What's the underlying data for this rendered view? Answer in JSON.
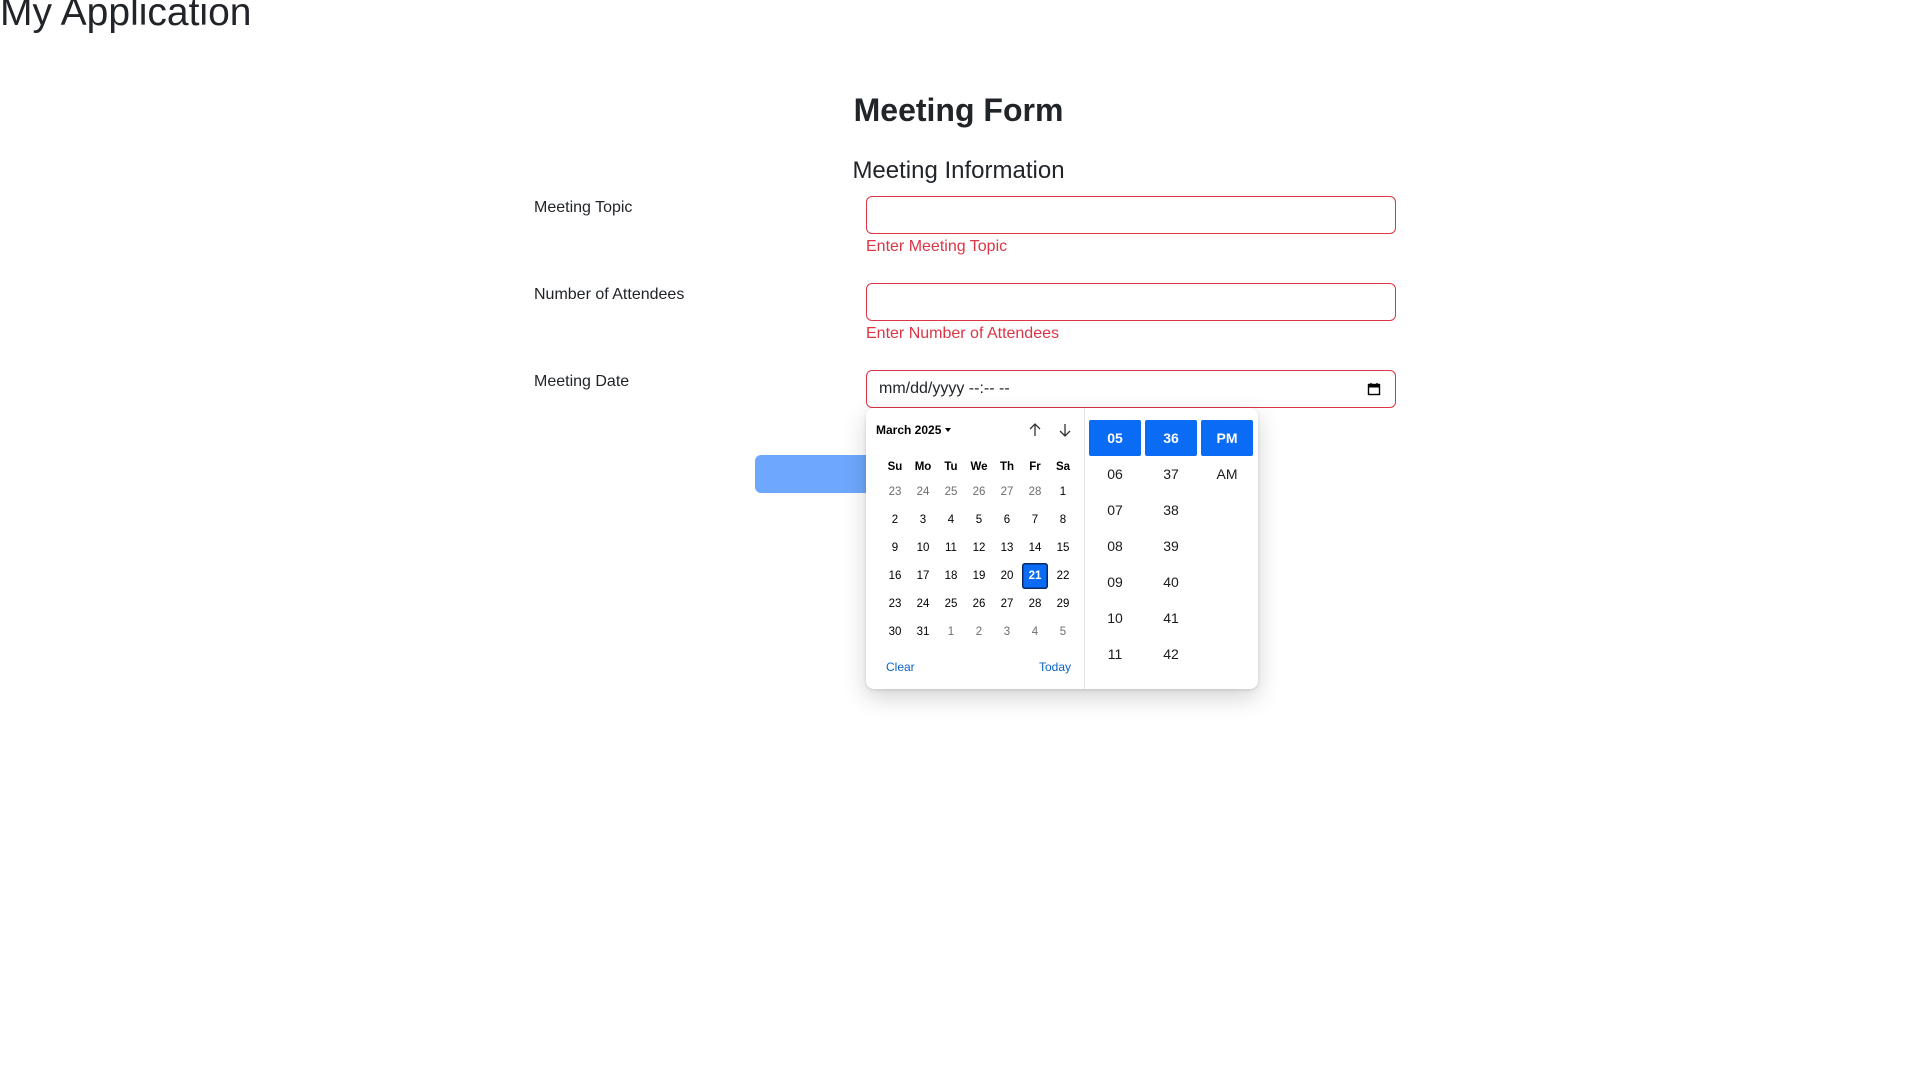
{
  "app": {
    "title": "My Application"
  },
  "form": {
    "title": "Meeting Form",
    "section_title": "Meeting Information",
    "topic": {
      "label": "Meeting Topic",
      "value": "",
      "error": "Enter Meeting Topic"
    },
    "attendees": {
      "label": "Number of Attendees",
      "value": "",
      "error": "Enter Number of Attendees"
    },
    "date": {
      "label": "Meeting Date",
      "placeholder": "mm/dd/yyyy --:-- --"
    },
    "submit_label": ""
  },
  "picker": {
    "month_label": "March 2025",
    "weekdays": [
      "Su",
      "Mo",
      "Tu",
      "We",
      "Th",
      "Fr",
      "Sa"
    ],
    "weeks": [
      [
        "23",
        "24",
        "25",
        "26",
        "27",
        "28",
        "1"
      ],
      [
        "2",
        "3",
        "4",
        "5",
        "6",
        "7",
        "8"
      ],
      [
        "9",
        "10",
        "11",
        "12",
        "13",
        "14",
        "15"
      ],
      [
        "16",
        "17",
        "18",
        "19",
        "20",
        "21",
        "22"
      ],
      [
        "23",
        "24",
        "25",
        "26",
        "27",
        "28",
        "29"
      ],
      [
        "30",
        "31",
        "1",
        "2",
        "3",
        "4",
        "5"
      ]
    ],
    "selected_day": "21",
    "clear_label": "Clear",
    "today_label": "Today",
    "hours": [
      "05",
      "06",
      "07",
      "08",
      "09",
      "10",
      "11"
    ],
    "minutes": [
      "36",
      "37",
      "38",
      "39",
      "40",
      "41",
      "42"
    ],
    "meridiem": [
      "PM",
      "AM"
    ],
    "selected_hour": "05",
    "selected_minute": "36",
    "selected_meridiem": "PM"
  },
  "colors": {
    "error": "#dc3545",
    "accent": "#0a6cf5",
    "submit_disabled": "#6ea8fe",
    "link": "#0a64c8"
  }
}
